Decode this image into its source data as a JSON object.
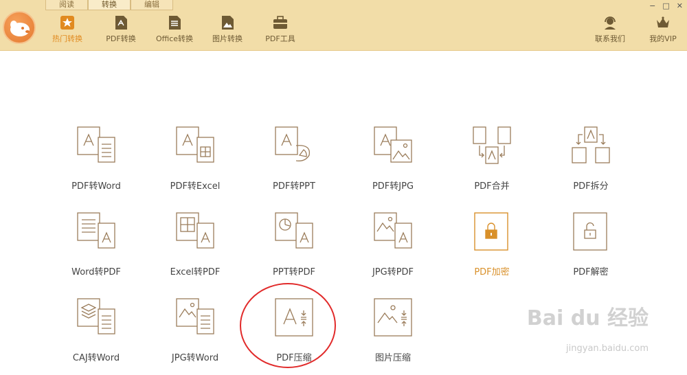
{
  "top_tabs": [
    {
      "label": "阅读"
    },
    {
      "label": "转换"
    },
    {
      "label": "编辑"
    }
  ],
  "window_controls": {
    "minimize": "−",
    "restore": "□",
    "close": "✕"
  },
  "toolbar": {
    "items": [
      {
        "label": "热门转换",
        "icon": "star-icon",
        "active": true
      },
      {
        "label": "PDF转换",
        "icon": "pdf-icon"
      },
      {
        "label": "Office转换",
        "icon": "office-doc-icon"
      },
      {
        "label": "图片转换",
        "icon": "image-icon"
      },
      {
        "label": "PDF工具",
        "icon": "toolbox-icon"
      }
    ],
    "right": [
      {
        "label": "联系我们",
        "icon": "headset-icon"
      },
      {
        "label": "我的VIP",
        "icon": "crown-icon"
      }
    ]
  },
  "grid": [
    {
      "label": "PDF转Word",
      "icon": "pdf-to-word-icon"
    },
    {
      "label": "PDF转Excel",
      "icon": "pdf-to-excel-icon"
    },
    {
      "label": "PDF转PPT",
      "icon": "pdf-to-ppt-icon"
    },
    {
      "label": "PDF转JPG",
      "icon": "pdf-to-jpg-icon"
    },
    {
      "label": "PDF合并",
      "icon": "pdf-merge-icon"
    },
    {
      "label": "PDF拆分",
      "icon": "pdf-split-icon"
    },
    {
      "label": "Word转PDF",
      "icon": "word-to-pdf-icon"
    },
    {
      "label": "Excel转PDF",
      "icon": "excel-to-pdf-icon"
    },
    {
      "label": "PPT转PDF",
      "icon": "ppt-to-pdf-icon"
    },
    {
      "label": "JPG转PDF",
      "icon": "jpg-to-pdf-icon"
    },
    {
      "label": "PDF加密",
      "icon": "pdf-encrypt-icon",
      "highlight": true
    },
    {
      "label": "PDF解密",
      "icon": "pdf-decrypt-icon"
    },
    {
      "label": "CAJ转Word",
      "icon": "caj-to-word-icon"
    },
    {
      "label": "JPG转Word",
      "icon": "jpg-to-word-icon"
    },
    {
      "label": "PDF压缩",
      "icon": "pdf-compress-icon",
      "circled": true
    },
    {
      "label": "图片压缩",
      "icon": "image-compress-icon"
    }
  ],
  "colors": {
    "header_bg": "#f2dda8",
    "accent": "#e18a1f",
    "icon_stroke": "#9a7c5a",
    "highlight": "#d9902a",
    "annotation": "#e12a2a"
  },
  "watermark": {
    "text": "Bai du 经验",
    "sub": "jingyan.baidu.com"
  }
}
